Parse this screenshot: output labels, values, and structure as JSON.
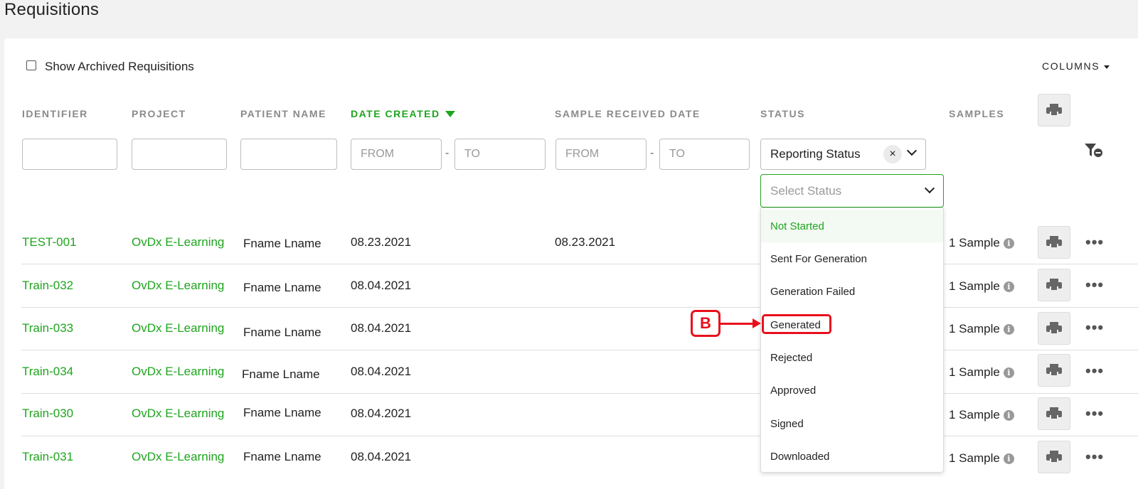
{
  "page": {
    "title": "Requisitions"
  },
  "toolbar": {
    "show_archived_label": "Show Archived Requisitions",
    "columns_label": "COLUMNS"
  },
  "columns": {
    "identifier": "IDENTIFIER",
    "project": "PROJECT",
    "patient_name": "PATIENT NAME",
    "date_created": "DATE CREATED",
    "sample_received_date": "SAMPLE RECEIVED DATE",
    "status": "STATUS",
    "samples": "SAMPLES"
  },
  "filters": {
    "date_created_from": "FROM",
    "date_created_to": "TO",
    "sample_received_from": "FROM",
    "sample_received_to": "TO",
    "range_separator": "-",
    "status_type": "Reporting Status",
    "status_clear": "×",
    "select_status_placeholder": "Select Status"
  },
  "status_options": [
    "Not Started",
    "Sent For Generation",
    "Generation Failed",
    "Generated",
    "Rejected",
    "Approved",
    "Signed",
    "Downloaded"
  ],
  "rows": [
    {
      "identifier": "TEST-001",
      "project": "OvDx E-Learning",
      "patient": "Fname Lname",
      "date_created": "08.23.2021",
      "sample_received": "08.23.2021",
      "samples": "1 Sample"
    },
    {
      "identifier": "Train-032",
      "project": "OvDx E-Learning",
      "patient": "Fname Lname",
      "date_created": "08.04.2021",
      "sample_received": "",
      "samples": "1 Sample"
    },
    {
      "identifier": "Train-033",
      "project": "OvDx E-Learning",
      "patient": "Fname Lname",
      "date_created": "08.04.2021",
      "sample_received": "",
      "samples": "1 Sample"
    },
    {
      "identifier": "Train-034",
      "project": "OvDx E-Learning",
      "patient": "Fname Lname",
      "date_created": "08.04.2021",
      "sample_received": "",
      "samples": "1 Sample"
    },
    {
      "identifier": "Train-030",
      "project": "OvDx E-Learning",
      "patient": "Fname Lname",
      "date_created": "08.04.2021",
      "sample_received": "",
      "samples": "1 Sample"
    },
    {
      "identifier": "Train-031",
      "project": "OvDx E-Learning",
      "patient": "Fname Lname",
      "date_created": "08.04.2021",
      "sample_received": "",
      "samples": "1 Sample"
    }
  ],
  "annotation": {
    "label": "B"
  },
  "icons": {
    "info": "i",
    "more": "•••"
  },
  "colors": {
    "accent_green": "#1ea51e",
    "annotation_red": "#e8101c"
  }
}
